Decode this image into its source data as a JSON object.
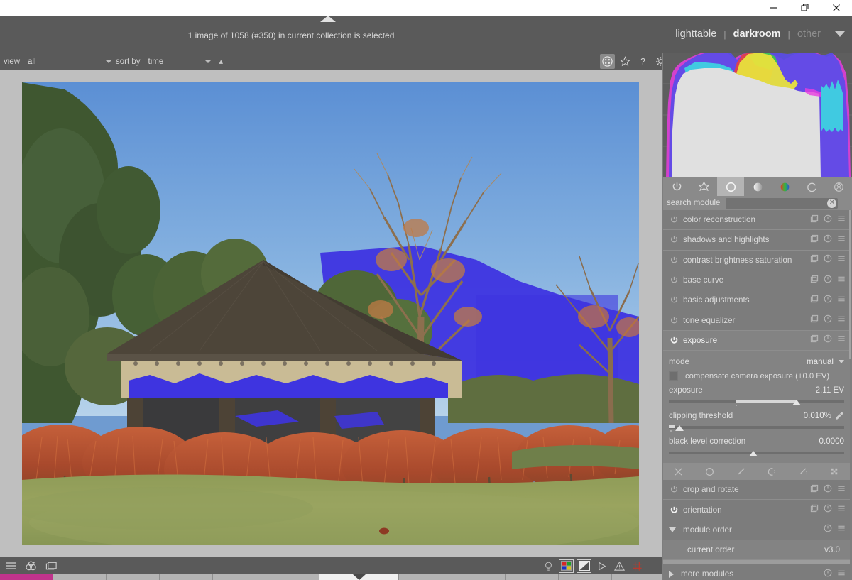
{
  "window": {
    "controls": [
      {
        "name": "minimize",
        "glyph": "minimize-icon"
      },
      {
        "name": "maximize",
        "glyph": "restore-icon"
      },
      {
        "name": "close",
        "glyph": "close-icon"
      }
    ]
  },
  "topbar": {
    "selection_status": "1 image of 1058 (#350) in current collection is selected",
    "views": [
      {
        "label": "lighttable",
        "state": "normal"
      },
      {
        "label": "darkroom",
        "state": "active"
      },
      {
        "label": "other",
        "state": "dim"
      }
    ],
    "separator": "|",
    "caret": "chevron-down-icon"
  },
  "toolbar": {
    "view_label": "view",
    "view_value": "all",
    "sort_label": "sort by",
    "sort_value": "time",
    "sort_direction": "ascending",
    "icons": [
      {
        "name": "grid-overlay-icon",
        "selected": true
      },
      {
        "name": "star-rating-icon",
        "selected": false
      },
      {
        "name": "help-icon",
        "selected": false
      },
      {
        "name": "preferences-gear-icon",
        "selected": false
      }
    ]
  },
  "bottombar": {
    "left_icons": [
      {
        "name": "hamburger-menu-icon"
      },
      {
        "name": "color-label-icon"
      },
      {
        "name": "duplicate-display-icon"
      }
    ],
    "right_icons": [
      {
        "name": "focus-peaking-bulb-icon",
        "selected": false
      },
      {
        "name": "color-assessment-icon",
        "selected": true
      },
      {
        "name": "iso12646-contrast-icon",
        "selected": true
      },
      {
        "name": "gamut-check-icon",
        "selected": false
      },
      {
        "name": "raw-overexposed-warning-icon",
        "selected": false
      },
      {
        "name": "guide-lines-icon",
        "selected": false
      }
    ]
  },
  "right_panel": {
    "histogram": {
      "label": "histogram",
      "mode": "rgb-overlay"
    },
    "module_group_tabs": [
      {
        "name": "active-modules-icon",
        "selected": false
      },
      {
        "name": "favorites-star-icon",
        "selected": false
      },
      {
        "name": "technical-circle-icon",
        "selected": true
      },
      {
        "name": "grading-tone-icon",
        "selected": false
      },
      {
        "name": "color-modules-icon",
        "selected": false
      },
      {
        "name": "correction-modules-icon",
        "selected": false
      },
      {
        "name": "effects-modules-icon",
        "selected": false
      }
    ],
    "search": {
      "label": "search module",
      "value": "",
      "placeholder": "",
      "clear_icon": "clear-x-icon"
    },
    "modules": [
      {
        "name": "color reconstruction",
        "enabled": false,
        "expanded": false
      },
      {
        "name": "shadows and highlights",
        "enabled": false,
        "expanded": false
      },
      {
        "name": "contrast brightness saturation",
        "enabled": false,
        "expanded": false
      },
      {
        "name": "base curve",
        "enabled": false,
        "expanded": false
      },
      {
        "name": "basic adjustments",
        "enabled": false,
        "expanded": false
      },
      {
        "name": "tone equalizer",
        "enabled": false,
        "expanded": false
      },
      {
        "name": "exposure",
        "enabled": true,
        "expanded": true
      }
    ],
    "module_row_icons": [
      {
        "name": "multi-instance-icon"
      },
      {
        "name": "reset-parameters-icon"
      },
      {
        "name": "presets-menu-icon"
      }
    ],
    "exposure": {
      "mode_label": "mode",
      "mode_value": "manual",
      "compensate_label": "compensate camera exposure (+0.0 EV)",
      "compensate_checked": false,
      "sliders": [
        {
          "label": "exposure",
          "value": "2.11 EV",
          "fill_start_pct": 38,
          "knob_pct": 73,
          "dot_pct": 38
        },
        {
          "label": "clipping threshold",
          "value": "0.010%",
          "fill_start_pct": 0,
          "knob_pct": 6,
          "dot_pct": 2,
          "has_picker": true
        },
        {
          "label": "black level correction",
          "value": "0.0000",
          "fill_start_pct": 0,
          "knob_pct": 48,
          "dot_pct": 48
        }
      ],
      "picker_icon": "color-picker-icon"
    },
    "blend_modes": [
      {
        "name": "blend-off-icon"
      },
      {
        "name": "blend-uniformly-icon"
      },
      {
        "name": "blend-drawn-mask-icon"
      },
      {
        "name": "blend-parametric-mask-icon"
      },
      {
        "name": "blend-drawn-and-parametric-mask-icon"
      },
      {
        "name": "blend-raster-mask-icon"
      }
    ],
    "modules_after": [
      {
        "name": "crop and rotate",
        "enabled": false
      },
      {
        "name": "orientation",
        "enabled": true
      }
    ],
    "module_order": {
      "title": "module order",
      "expanded": true,
      "current_order_label": "current order",
      "current_order_value": "v3.0"
    },
    "more_modules": {
      "title": "more modules",
      "expanded": false
    }
  },
  "colors": {
    "panel_bg": "#7e7e7e",
    "module_bg": "#7c7c7c",
    "module_active_bg": "#838383",
    "header_bg": "#5a5a5a",
    "canvas_bg": "#bfbfbf",
    "accent_text": "#f0f0f0",
    "clipping_overlay": "#3e34e0",
    "filmstrip_label": "#c0338c"
  }
}
